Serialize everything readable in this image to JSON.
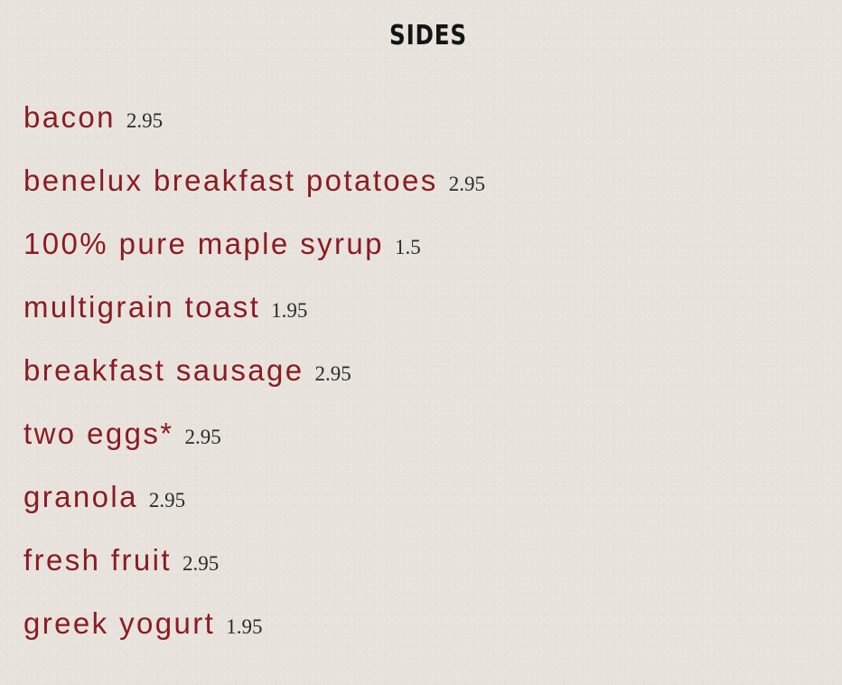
{
  "section": {
    "title": "SIDES",
    "items": [
      {
        "name": "bacon",
        "price": "2.95"
      },
      {
        "name": "benelux breakfast potatoes",
        "price": "2.95"
      },
      {
        "name": "100% pure maple syrup",
        "price": "1.5"
      },
      {
        "name": "multigrain toast",
        "price": "1.95"
      },
      {
        "name": "breakfast sausage",
        "price": "2.95"
      },
      {
        "name": "two eggs*",
        "price": "2.95"
      },
      {
        "name": "granola",
        "price": "2.95"
      },
      {
        "name": "fresh fruit",
        "price": "2.95"
      },
      {
        "name": "greek yogurt",
        "price": "1.95"
      }
    ]
  },
  "colors": {
    "background": "#e8e2dc",
    "item_name": "#8a1c22",
    "price": "#2a2a2a",
    "title": "#141414"
  }
}
